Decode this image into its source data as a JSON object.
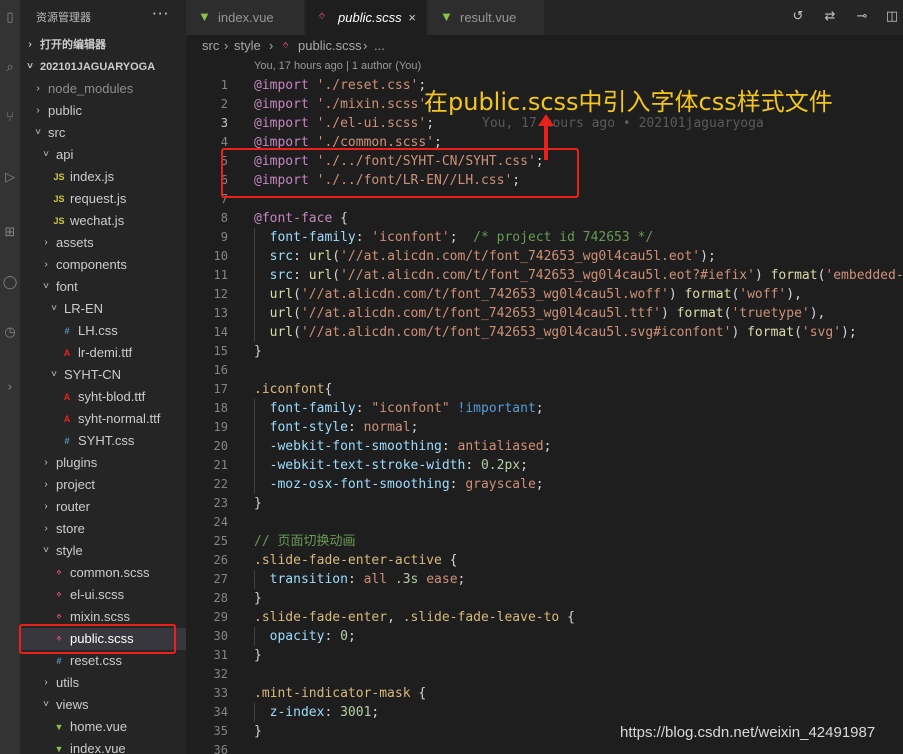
{
  "sidebar": {
    "title": "资源管理器",
    "more": "···",
    "items": [
      {
        "label": "打开的编辑器",
        "indent": 0,
        "twisty": "›",
        "icon": "",
        "section": true
      },
      {
        "label": "202101JAGUARYOGA",
        "indent": 0,
        "twisty": "˅",
        "icon": "",
        "section": true
      },
      {
        "label": "node_modules",
        "indent": 1,
        "twisty": "›",
        "icon": "",
        "dim": true
      },
      {
        "label": "public",
        "indent": 1,
        "twisty": "›",
        "icon": ""
      },
      {
        "label": "src",
        "indent": 1,
        "twisty": "˅",
        "icon": ""
      },
      {
        "label": "api",
        "indent": 2,
        "twisty": "˅",
        "icon": ""
      },
      {
        "label": "index.js",
        "indent": 3,
        "twisty": "",
        "icon": "js"
      },
      {
        "label": "request.js",
        "indent": 3,
        "twisty": "",
        "icon": "js"
      },
      {
        "label": "wechat.js",
        "indent": 3,
        "twisty": "",
        "icon": "js"
      },
      {
        "label": "assets",
        "indent": 2,
        "twisty": "›",
        "icon": ""
      },
      {
        "label": "components",
        "indent": 2,
        "twisty": "›",
        "icon": ""
      },
      {
        "label": "font",
        "indent": 2,
        "twisty": "˅",
        "icon": ""
      },
      {
        "label": "LR-EN",
        "indent": 3,
        "twisty": "˅",
        "icon": ""
      },
      {
        "label": "LH.css",
        "indent": 4,
        "twisty": "",
        "icon": "css"
      },
      {
        "label": "lr-demi.ttf",
        "indent": 4,
        "twisty": "",
        "icon": "font"
      },
      {
        "label": "SYHT-CN",
        "indent": 3,
        "twisty": "˅",
        "icon": ""
      },
      {
        "label": "syht-blod.ttf",
        "indent": 4,
        "twisty": "",
        "icon": "font"
      },
      {
        "label": "syht-normal.ttf",
        "indent": 4,
        "twisty": "",
        "icon": "font"
      },
      {
        "label": "SYHT.css",
        "indent": 4,
        "twisty": "",
        "icon": "css"
      },
      {
        "label": "plugins",
        "indent": 2,
        "twisty": "›",
        "icon": ""
      },
      {
        "label": "project",
        "indent": 2,
        "twisty": "›",
        "icon": ""
      },
      {
        "label": "router",
        "indent": 2,
        "twisty": "›",
        "icon": ""
      },
      {
        "label": "store",
        "indent": 2,
        "twisty": "›",
        "icon": ""
      },
      {
        "label": "style",
        "indent": 2,
        "twisty": "˅",
        "icon": ""
      },
      {
        "label": "common.scss",
        "indent": 3,
        "twisty": "",
        "icon": "scss"
      },
      {
        "label": "el-ui.scss",
        "indent": 3,
        "twisty": "",
        "icon": "scss"
      },
      {
        "label": "mixin.scss",
        "indent": 3,
        "twisty": "",
        "icon": "scss"
      },
      {
        "label": "public.scss",
        "indent": 3,
        "twisty": "",
        "icon": "scss",
        "active": true
      },
      {
        "label": "reset.css",
        "indent": 3,
        "twisty": "",
        "icon": "css"
      },
      {
        "label": "utils",
        "indent": 2,
        "twisty": "›",
        "icon": ""
      },
      {
        "label": "views",
        "indent": 2,
        "twisty": "˅",
        "icon": ""
      },
      {
        "label": "home.vue",
        "indent": 3,
        "twisty": "",
        "icon": "vue"
      },
      {
        "label": "index.vue",
        "indent": 3,
        "twisty": "",
        "icon": "vue"
      }
    ]
  },
  "tabs": [
    {
      "label": "index.vue",
      "icon": "vue",
      "active": false
    },
    {
      "label": "public.scss",
      "icon": "scss",
      "active": true,
      "close": "×"
    },
    {
      "label": "result.vue",
      "icon": "vue",
      "active": false
    }
  ],
  "breadcrumb": {
    "parts": [
      "src",
      "›",
      "style",
      "›",
      "public.scss",
      "›",
      "..."
    ]
  },
  "blame_top": "You, 17 hours ago | 1 author (You)",
  "inline_blame": "You, 17 hours ago • 202101jaguaryoga",
  "annotation": "在public.scss中引入字体css样式文件",
  "watermark": "https://blog.csdn.net/weixin_42491987",
  "colors": {
    "highlight_box": "#e8221a",
    "annotation": "#f4c61c",
    "accent_js": "#cbcb41",
    "accent_scss": "#f55385",
    "accent_css": "#519aba",
    "accent_vue": "#8dc149"
  },
  "code": [
    {
      "n": "1",
      "tokens": [
        [
          "c-kw",
          "@import"
        ],
        [
          "c-pun",
          " "
        ],
        [
          "c-str",
          "'./reset.css'"
        ],
        [
          "c-pun",
          ";"
        ]
      ]
    },
    {
      "n": "2",
      "tokens": [
        [
          "c-kw",
          "@import"
        ],
        [
          "c-pun",
          " "
        ],
        [
          "c-str",
          "'./mixin.scss'"
        ],
        [
          "c-pun",
          ";"
        ]
      ]
    },
    {
      "n": "3",
      "cur": true,
      "blame": true,
      "tokens": [
        [
          "c-kw",
          "@import"
        ],
        [
          "c-pun",
          " "
        ],
        [
          "c-str",
          "'./el-ui.scss'"
        ],
        [
          "c-pun",
          ";"
        ]
      ]
    },
    {
      "n": "4",
      "tokens": [
        [
          "c-kw",
          "@import"
        ],
        [
          "c-pun",
          " "
        ],
        [
          "c-str",
          "'./common.scss'"
        ],
        [
          "c-pun",
          ";"
        ]
      ]
    },
    {
      "n": "5",
      "tokens": [
        [
          "c-kw",
          "@import"
        ],
        [
          "c-pun",
          " "
        ],
        [
          "c-str",
          "'./../font/SYHT-CN/SYHT.css'"
        ],
        [
          "c-pun",
          ";"
        ]
      ]
    },
    {
      "n": "6",
      "tokens": [
        [
          "c-kw",
          "@import"
        ],
        [
          "c-pun",
          " "
        ],
        [
          "c-str",
          "'./../font/LR-EN//LH.css'"
        ],
        [
          "c-pun",
          ";"
        ]
      ]
    },
    {
      "n": "7",
      "tokens": []
    },
    {
      "n": "8",
      "tokens": [
        [
          "c-kw",
          "@font-face"
        ],
        [
          "c-pun",
          " {"
        ]
      ]
    },
    {
      "n": "9",
      "guide": true,
      "tokens": [
        [
          "c-pun",
          "  "
        ],
        [
          "c-prop",
          "font-family"
        ],
        [
          "c-pun",
          ": "
        ],
        [
          "c-str",
          "'iconfont'"
        ],
        [
          "c-pun",
          ";  "
        ],
        [
          "c-cmt",
          "/* project id 742653 */"
        ]
      ]
    },
    {
      "n": "10",
      "guide": true,
      "tokens": [
        [
          "c-pun",
          "  "
        ],
        [
          "c-prop",
          "src"
        ],
        [
          "c-pun",
          ": "
        ],
        [
          "c-fn",
          "url"
        ],
        [
          "c-pun",
          "("
        ],
        [
          "c-str",
          "'//at.alicdn.com/t/font_742653_wg0l4cau5l.eot'"
        ],
        [
          "c-pun",
          ");"
        ]
      ]
    },
    {
      "n": "11",
      "guide": true,
      "tokens": [
        [
          "c-pun",
          "  "
        ],
        [
          "c-prop",
          "src"
        ],
        [
          "c-pun",
          ": "
        ],
        [
          "c-fn",
          "url"
        ],
        [
          "c-pun",
          "("
        ],
        [
          "c-str",
          "'//at.alicdn.com/t/font_742653_wg0l4cau5l.eot?#iefix'"
        ],
        [
          "c-pun",
          ") "
        ],
        [
          "c-fn",
          "format"
        ],
        [
          "c-pun",
          "("
        ],
        [
          "c-str",
          "'embedded-op"
        ]
      ]
    },
    {
      "n": "12",
      "guide": true,
      "tokens": [
        [
          "c-pun",
          "  "
        ],
        [
          "c-fn",
          "url"
        ],
        [
          "c-pun",
          "("
        ],
        [
          "c-str",
          "'//at.alicdn.com/t/font_742653_wg0l4cau5l.woff'"
        ],
        [
          "c-pun",
          ") "
        ],
        [
          "c-fn",
          "format"
        ],
        [
          "c-pun",
          "("
        ],
        [
          "c-str",
          "'woff'"
        ],
        [
          "c-pun",
          "),"
        ]
      ]
    },
    {
      "n": "13",
      "guide": true,
      "tokens": [
        [
          "c-pun",
          "  "
        ],
        [
          "c-fn",
          "url"
        ],
        [
          "c-pun",
          "("
        ],
        [
          "c-str",
          "'//at.alicdn.com/t/font_742653_wg0l4cau5l.ttf'"
        ],
        [
          "c-pun",
          ") "
        ],
        [
          "c-fn",
          "format"
        ],
        [
          "c-pun",
          "("
        ],
        [
          "c-str",
          "'truetype'"
        ],
        [
          "c-pun",
          "),"
        ]
      ]
    },
    {
      "n": "14",
      "guide": true,
      "tokens": [
        [
          "c-pun",
          "  "
        ],
        [
          "c-fn",
          "url"
        ],
        [
          "c-pun",
          "("
        ],
        [
          "c-str",
          "'//at.alicdn.com/t/font_742653_wg0l4cau5l.svg#iconfont'"
        ],
        [
          "c-pun",
          ") "
        ],
        [
          "c-fn",
          "format"
        ],
        [
          "c-pun",
          "("
        ],
        [
          "c-str",
          "'svg'"
        ],
        [
          "c-pun",
          ");"
        ]
      ]
    },
    {
      "n": "15",
      "tokens": [
        [
          "c-pun",
          "}"
        ]
      ]
    },
    {
      "n": "16",
      "tokens": []
    },
    {
      "n": "17",
      "tokens": [
        [
          "c-sel",
          ".iconfont"
        ],
        [
          "c-pun",
          "{"
        ]
      ]
    },
    {
      "n": "18",
      "guide": true,
      "tokens": [
        [
          "c-pun",
          "  "
        ],
        [
          "c-prop",
          "font-family"
        ],
        [
          "c-pun",
          ": "
        ],
        [
          "c-str",
          "\"iconfont\""
        ],
        [
          "c-pun",
          " "
        ],
        [
          "c-imp",
          "!important"
        ],
        [
          "c-pun",
          ";"
        ]
      ]
    },
    {
      "n": "19",
      "guide": true,
      "tokens": [
        [
          "c-pun",
          "  "
        ],
        [
          "c-prop",
          "font-style"
        ],
        [
          "c-pun",
          ": "
        ],
        [
          "c-str",
          "normal"
        ],
        [
          "c-pun",
          ";"
        ]
      ]
    },
    {
      "n": "20",
      "guide": true,
      "tokens": [
        [
          "c-pun",
          "  "
        ],
        [
          "c-prop",
          "-webkit-font-smoothing"
        ],
        [
          "c-pun",
          ": "
        ],
        [
          "c-str",
          "antialiased"
        ],
        [
          "c-pun",
          ";"
        ]
      ]
    },
    {
      "n": "21",
      "guide": true,
      "tokens": [
        [
          "c-pun",
          "  "
        ],
        [
          "c-prop",
          "-webkit-text-stroke-width"
        ],
        [
          "c-pun",
          ": "
        ],
        [
          "c-num",
          "0.2px"
        ],
        [
          "c-pun",
          ";"
        ]
      ]
    },
    {
      "n": "22",
      "guide": true,
      "tokens": [
        [
          "c-pun",
          "  "
        ],
        [
          "c-prop",
          "-moz-osx-font-smoothing"
        ],
        [
          "c-pun",
          ": "
        ],
        [
          "c-str",
          "grayscale"
        ],
        [
          "c-pun",
          ";"
        ]
      ]
    },
    {
      "n": "23",
      "tokens": [
        [
          "c-pun",
          "}"
        ]
      ]
    },
    {
      "n": "24",
      "tokens": []
    },
    {
      "n": "25",
      "tokens": [
        [
          "c-cmt",
          "// 页面切换动画"
        ]
      ]
    },
    {
      "n": "26",
      "tokens": [
        [
          "c-sel",
          ".slide-fade-enter-active"
        ],
        [
          "c-pun",
          " {"
        ]
      ]
    },
    {
      "n": "27",
      "guide": true,
      "tokens": [
        [
          "c-pun",
          "  "
        ],
        [
          "c-prop",
          "transition"
        ],
        [
          "c-pun",
          ": "
        ],
        [
          "c-str",
          "all "
        ],
        [
          "c-num",
          ".3s"
        ],
        [
          "c-str",
          " ease"
        ],
        [
          "c-pun",
          ";"
        ]
      ]
    },
    {
      "n": "28",
      "tokens": [
        [
          "c-pun",
          "}"
        ]
      ]
    },
    {
      "n": "29",
      "tokens": [
        [
          "c-sel",
          ".slide-fade-enter"
        ],
        [
          "c-pun",
          ", "
        ],
        [
          "c-sel",
          ".slide-fade-leave-to"
        ],
        [
          "c-pun",
          " {"
        ]
      ]
    },
    {
      "n": "30",
      "guide": true,
      "tokens": [
        [
          "c-pun",
          "  "
        ],
        [
          "c-prop",
          "opacity"
        ],
        [
          "c-pun",
          ": "
        ],
        [
          "c-num",
          "0"
        ],
        [
          "c-pun",
          ";"
        ]
      ]
    },
    {
      "n": "31",
      "tokens": [
        [
          "c-pun",
          "}"
        ]
      ]
    },
    {
      "n": "32",
      "tokens": []
    },
    {
      "n": "33",
      "tokens": [
        [
          "c-sel",
          ".mint-indicator-mask"
        ],
        [
          "c-pun",
          " {"
        ]
      ]
    },
    {
      "n": "34",
      "guide": true,
      "tokens": [
        [
          "c-pun",
          "  "
        ],
        [
          "c-prop",
          "z-index"
        ],
        [
          "c-pun",
          ": "
        ],
        [
          "c-num",
          "3001"
        ],
        [
          "c-pun",
          ";"
        ]
      ]
    },
    {
      "n": "35",
      "tokens": [
        [
          "c-pun",
          "}"
        ]
      ]
    },
    {
      "n": "36",
      "tokens": []
    }
  ]
}
